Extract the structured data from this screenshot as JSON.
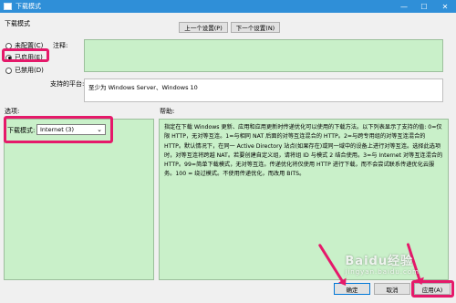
{
  "window": {
    "title": "下载模式",
    "minimize": "—",
    "maximize": "☐",
    "close": "✕"
  },
  "header": {
    "setting_title": "下载模式",
    "prev_button": "上一个设置(P)",
    "next_button": "下一个设置(N)"
  },
  "state": {
    "options": [
      {
        "label": "未配置(C)",
        "selected": false
      },
      {
        "label": "已启用(E)",
        "selected": true
      },
      {
        "label": "已禁用(D)",
        "selected": false
      }
    ]
  },
  "comment": {
    "label": "注释:"
  },
  "supported": {
    "label": "支持的平台:",
    "value": "至少为 Windows Server、Windows 10"
  },
  "options_section": {
    "label": "选项:",
    "field_label": "下载模式:",
    "selected_value": "Internet (3)"
  },
  "help_section": {
    "label": "帮助:",
    "text": "指定在下载 Windows 更新、应用和应用更新时传递优化可以使用的下载方法。以下列表显示了支持的值: 0=仅限 HTTP，无对等互连。1=与相同 NAT 后面的对等互连混合的 HTTP。2=与跨专用组的对等互连混合的 HTTP。默认情况下，在同一 Active Directory 站点(如果存在)或同一域中的设备上进行对等互连。选择此选项时，对等互连将跨越 NAT。若要创建自定义组，请将组 ID 与模式 2 结合使用。3=与 Internet 对等互连混合的 HTTP。99=简单下载模式，无对等互连。传递优化将仅使用 HTTP 进行下载，而不会尝试联系传递优化云服务。100 = 绕过模式。不使用传递优化，而改用 BITS。"
  },
  "footer": {
    "ok": "确定",
    "cancel": "取消",
    "apply": "应用(A)"
  },
  "watermark": {
    "brand": "Baidu经验",
    "sub": "jingyan.baidu.com"
  },
  "colors": {
    "accent": "#e5196a",
    "titlebar": "#2f8fd8",
    "panel": "#c9f0c9"
  }
}
